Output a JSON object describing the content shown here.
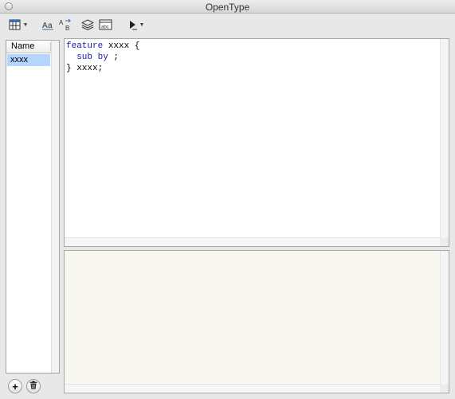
{
  "window": {
    "title": "OpenType"
  },
  "toolbar": {
    "icons": [
      "glyph-table-icon",
      "dropdown-arrow-icon",
      "font-spacing-icon",
      "substitution-icon",
      "layers-icon",
      "abc-text-icon",
      "play-icon",
      "dropdown-arrow-icon"
    ]
  },
  "features_list": {
    "header": "Name",
    "items": [
      {
        "label": "xxxx",
        "selected": true
      }
    ]
  },
  "editor": {
    "line1_keyword": "feature",
    "line1_rest": " xxxx {",
    "line2_indent": "  ",
    "line2_kw1": "sub",
    "line2_space": " ",
    "line2_kw2": "by",
    "line2_rest": " ;",
    "line3": "} xxxx;"
  },
  "buttons": {
    "add": "+",
    "delete_icon": "trash-icon"
  },
  "colors": {
    "selection": "#b5d5ff",
    "keyword": "#1a1aa6",
    "preview_bg": "#f8f8f0"
  }
}
